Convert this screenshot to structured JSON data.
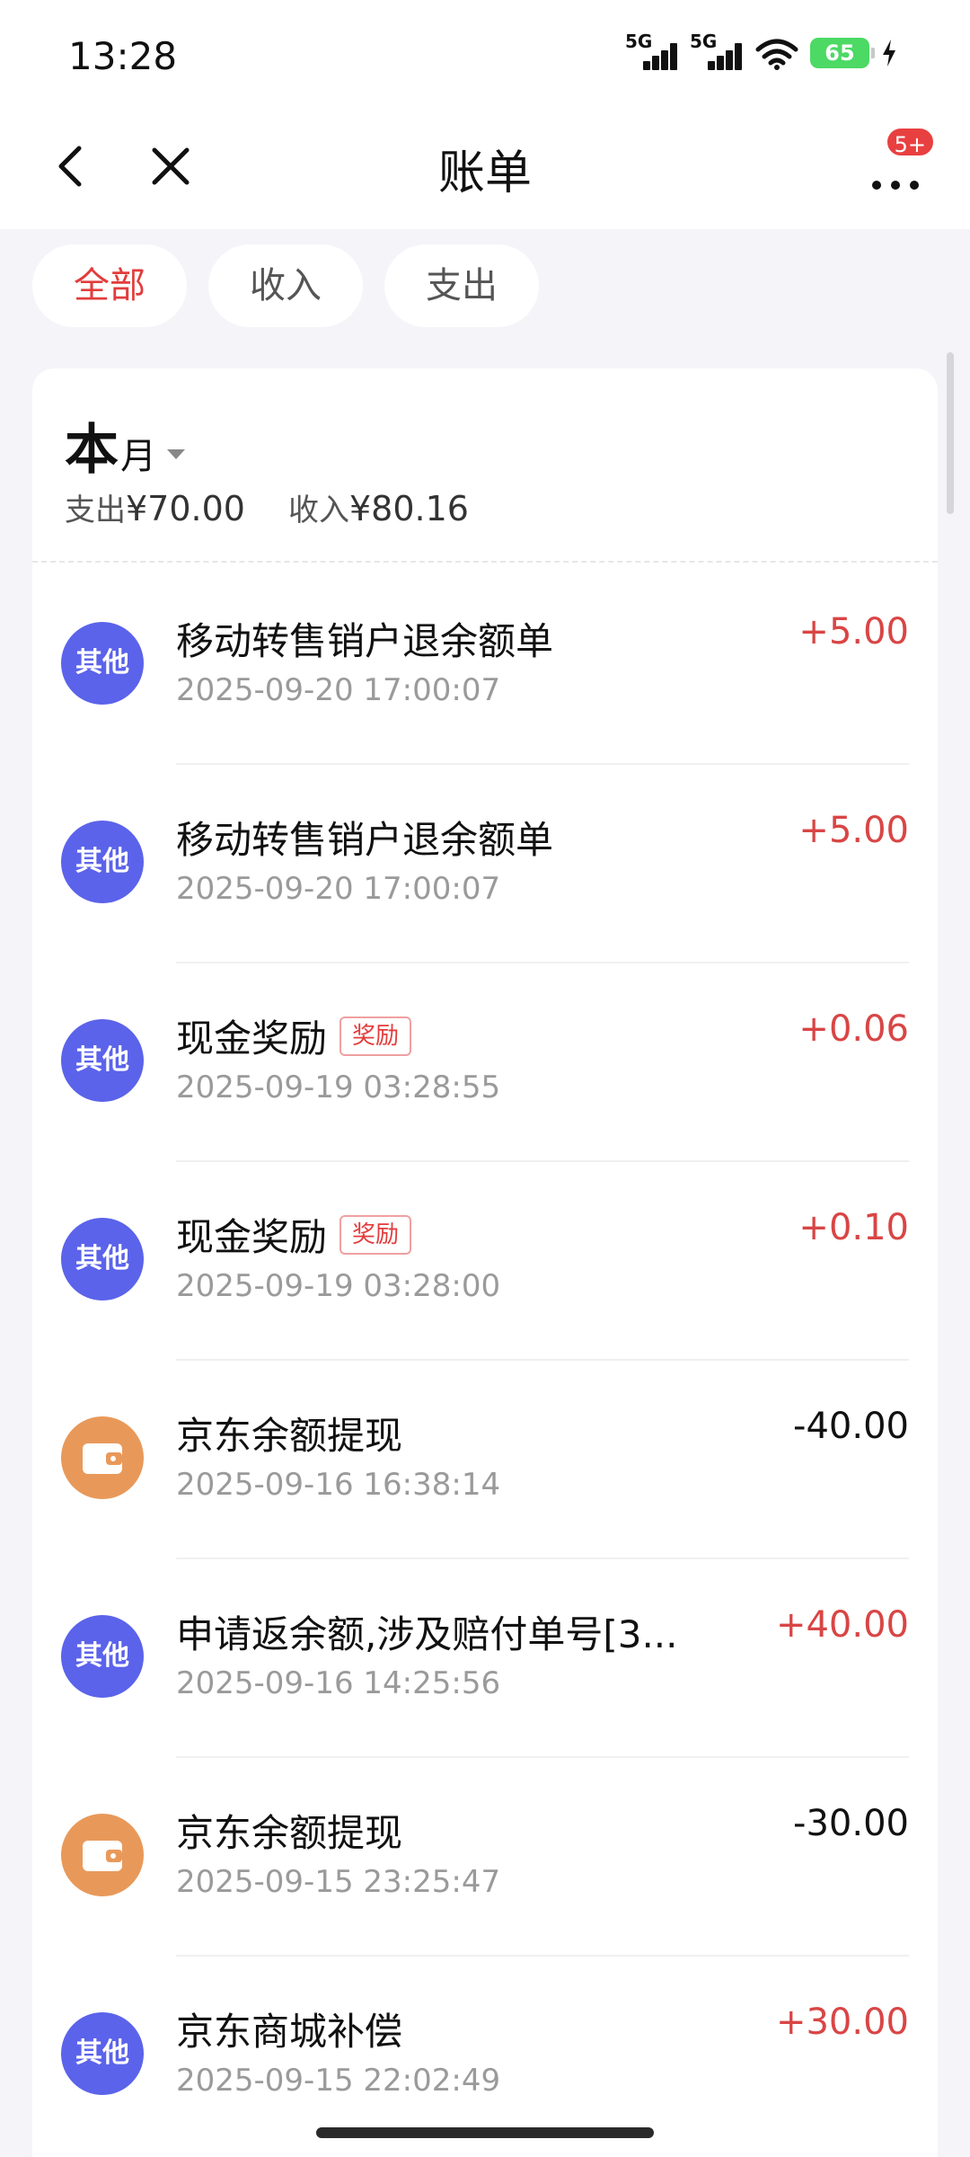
{
  "status": {
    "time": "13:28",
    "network1": "5G",
    "network2": "5G",
    "battery": "65"
  },
  "nav": {
    "title": "账单",
    "badge": "5+"
  },
  "filters": [
    {
      "label": "全部",
      "active": true
    },
    {
      "label": "收入",
      "active": false
    },
    {
      "label": "支出",
      "active": false
    }
  ],
  "summary": {
    "period_big": "本",
    "period_small": "月",
    "expense_label": "支出",
    "expense_amount": "¥70.00",
    "income_label": "收入",
    "income_amount": "¥80.16"
  },
  "transactions": [
    {
      "icon": "other",
      "icon_label": "其他",
      "title": "移动转售销户退余额单",
      "tag": "",
      "time": "2025-09-20 17:00:07",
      "amount": "+5.00",
      "type": "income"
    },
    {
      "icon": "other",
      "icon_label": "其他",
      "title": "移动转售销户退余额单",
      "tag": "",
      "time": "2025-09-20 17:00:07",
      "amount": "+5.00",
      "type": "income"
    },
    {
      "icon": "other",
      "icon_label": "其他",
      "title": "现金奖励",
      "tag": "奖励",
      "time": "2025-09-19 03:28:55",
      "amount": "+0.06",
      "type": "income"
    },
    {
      "icon": "other",
      "icon_label": "其他",
      "title": "现金奖励",
      "tag": "奖励",
      "time": "2025-09-19 03:28:00",
      "amount": "+0.10",
      "type": "income"
    },
    {
      "icon": "wallet",
      "icon_label": "",
      "title": "京东余额提现",
      "tag": "",
      "time": "2025-09-16 16:38:14",
      "amount": "-40.00",
      "type": "expense"
    },
    {
      "icon": "other",
      "icon_label": "其他",
      "title": "申请返余额,涉及赔付单号[3...",
      "tag": "",
      "time": "2025-09-16 14:25:56",
      "amount": "+40.00",
      "type": "income"
    },
    {
      "icon": "wallet",
      "icon_label": "",
      "title": "京东余额提现",
      "tag": "",
      "time": "2025-09-15 23:25:47",
      "amount": "-30.00",
      "type": "expense"
    },
    {
      "icon": "other",
      "icon_label": "其他",
      "title": "京东商城补偿",
      "tag": "",
      "time": "2025-09-15 22:02:49",
      "amount": "+30.00",
      "type": "income"
    }
  ],
  "colors": {
    "accent": "#e23c3c",
    "income": "#d94545",
    "other_icon": "#5b63ea",
    "wallet_icon": "#e8995a"
  }
}
